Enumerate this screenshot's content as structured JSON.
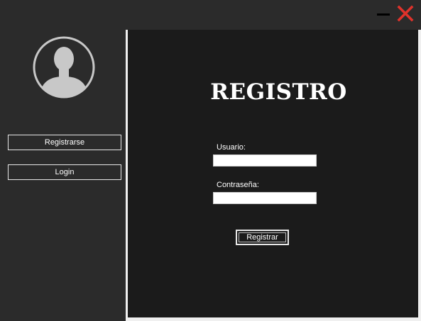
{
  "window": {
    "controls": {
      "minimize_icon": "minimize-icon",
      "close_icon": "close-icon",
      "close_color": "#e0322b"
    }
  },
  "sidebar": {
    "avatar_icon": "user-avatar-icon",
    "buttons": [
      {
        "label": "Registrarse"
      },
      {
        "label": "Login"
      }
    ]
  },
  "main": {
    "title": "REGISTRO",
    "form": {
      "username_label": "Usuario:",
      "username_value": "",
      "password_label": "Contraseña:",
      "password_value": "",
      "submit_label": "Registrar"
    }
  },
  "colors": {
    "window_bg": "#2b2b2b",
    "panel_bg": "#1b1b1b",
    "border": "#f0f0f0",
    "text": "#ffffff"
  }
}
